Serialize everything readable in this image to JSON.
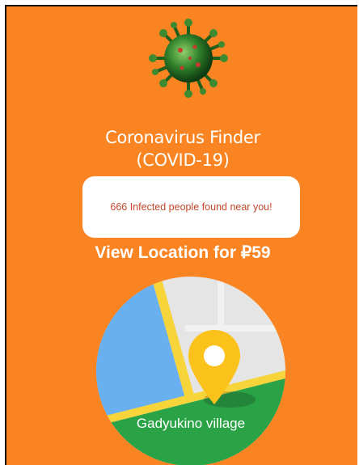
{
  "app": {
    "title_line1": "Coronavirus Finder",
    "title_line2": "(COVID-19)"
  },
  "notice": {
    "text": "666 Infected people found near you!"
  },
  "cta": {
    "label": "View Location for ₽59"
  },
  "map": {
    "location_label": "Gadyukino village",
    "icon": "location-pin-icon"
  },
  "colors": {
    "background": "#fa8422",
    "notice_text": "#c4472a",
    "map_water": "#68b0ef",
    "map_land": "#e5e5e5",
    "map_park": "#2aa347",
    "map_road": "#f7d43a",
    "pin": "#fbc21b"
  },
  "icons": {
    "virus": "virus-icon"
  }
}
